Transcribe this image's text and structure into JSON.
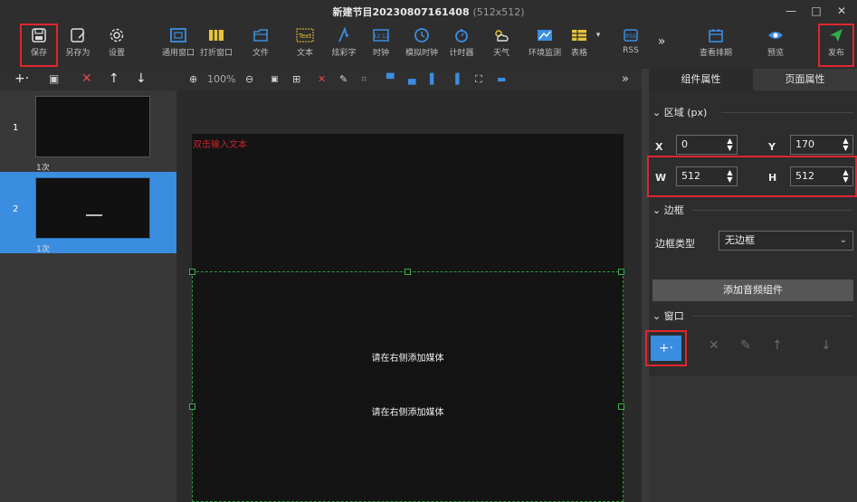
{
  "window": {
    "title": "新建节目20230807161408",
    "size_label": "(512x512)",
    "minimize": "—",
    "maximize": "□",
    "close": "✕"
  },
  "toolbar": {
    "items": [
      {
        "label": "保存",
        "icon": "save-icon"
      },
      {
        "label": "另存为",
        "icon": "save-as-icon"
      },
      {
        "label": "设置",
        "icon": "gear-icon"
      },
      {
        "label": "通用窗口",
        "icon": "window-icon"
      },
      {
        "label": "打折窗口",
        "icon": "split-window-icon"
      },
      {
        "label": "文件",
        "icon": "folder-icon"
      },
      {
        "label": "文本",
        "icon": "text-icon"
      },
      {
        "label": "炫彩字",
        "icon": "colorful-text-icon"
      },
      {
        "label": "时钟",
        "icon": "digital-clock-icon"
      },
      {
        "label": "模拟时钟",
        "icon": "analog-clock-icon"
      },
      {
        "label": "计时器",
        "icon": "timer-icon"
      },
      {
        "label": "天气",
        "icon": "weather-icon"
      },
      {
        "label": "环境监测",
        "icon": "environment-icon"
      },
      {
        "label": "表格",
        "icon": "table-icon"
      },
      {
        "label": "RSS",
        "icon": "rss-icon"
      },
      {
        "label": "查看排期",
        "icon": "calendar-icon"
      },
      {
        "label": "预览",
        "icon": "eye-icon"
      },
      {
        "label": "发布",
        "icon": "send-icon"
      }
    ],
    "more": "»"
  },
  "left_panel": {
    "toolbar": [
      "+·",
      "▣",
      "✕",
      "↑",
      "↓"
    ],
    "slides": [
      {
        "number": "1",
        "count": "1次"
      },
      {
        "number": "2",
        "count": "1次"
      }
    ]
  },
  "canvas": {
    "zoom": "100%",
    "more": "»",
    "placeholder_text": "双击输入文本",
    "media_hint_1": "请在右侧添加媒体",
    "media_hint_2": "请在右侧添加媒体"
  },
  "right_panel": {
    "tabs": [
      "组件属性",
      "页面属性"
    ],
    "region_section": "区域 (px)",
    "x_label": "X",
    "x_value": "0",
    "y_label": "Y",
    "y_value": "170",
    "w_label": "W",
    "w_value": "512",
    "h_label": "H",
    "h_value": "512",
    "border_section": "边框",
    "border_type_label": "边框类型",
    "border_type_value": "无边框",
    "add_audio_button": "添加音频组件",
    "window_section": "窗口",
    "add_button": "+·"
  },
  "colors": {
    "accent": "#3b8de0",
    "highlight_red": "#e0262f",
    "selection_green": "#2e9a3b",
    "send_green": "#2fae4a"
  }
}
